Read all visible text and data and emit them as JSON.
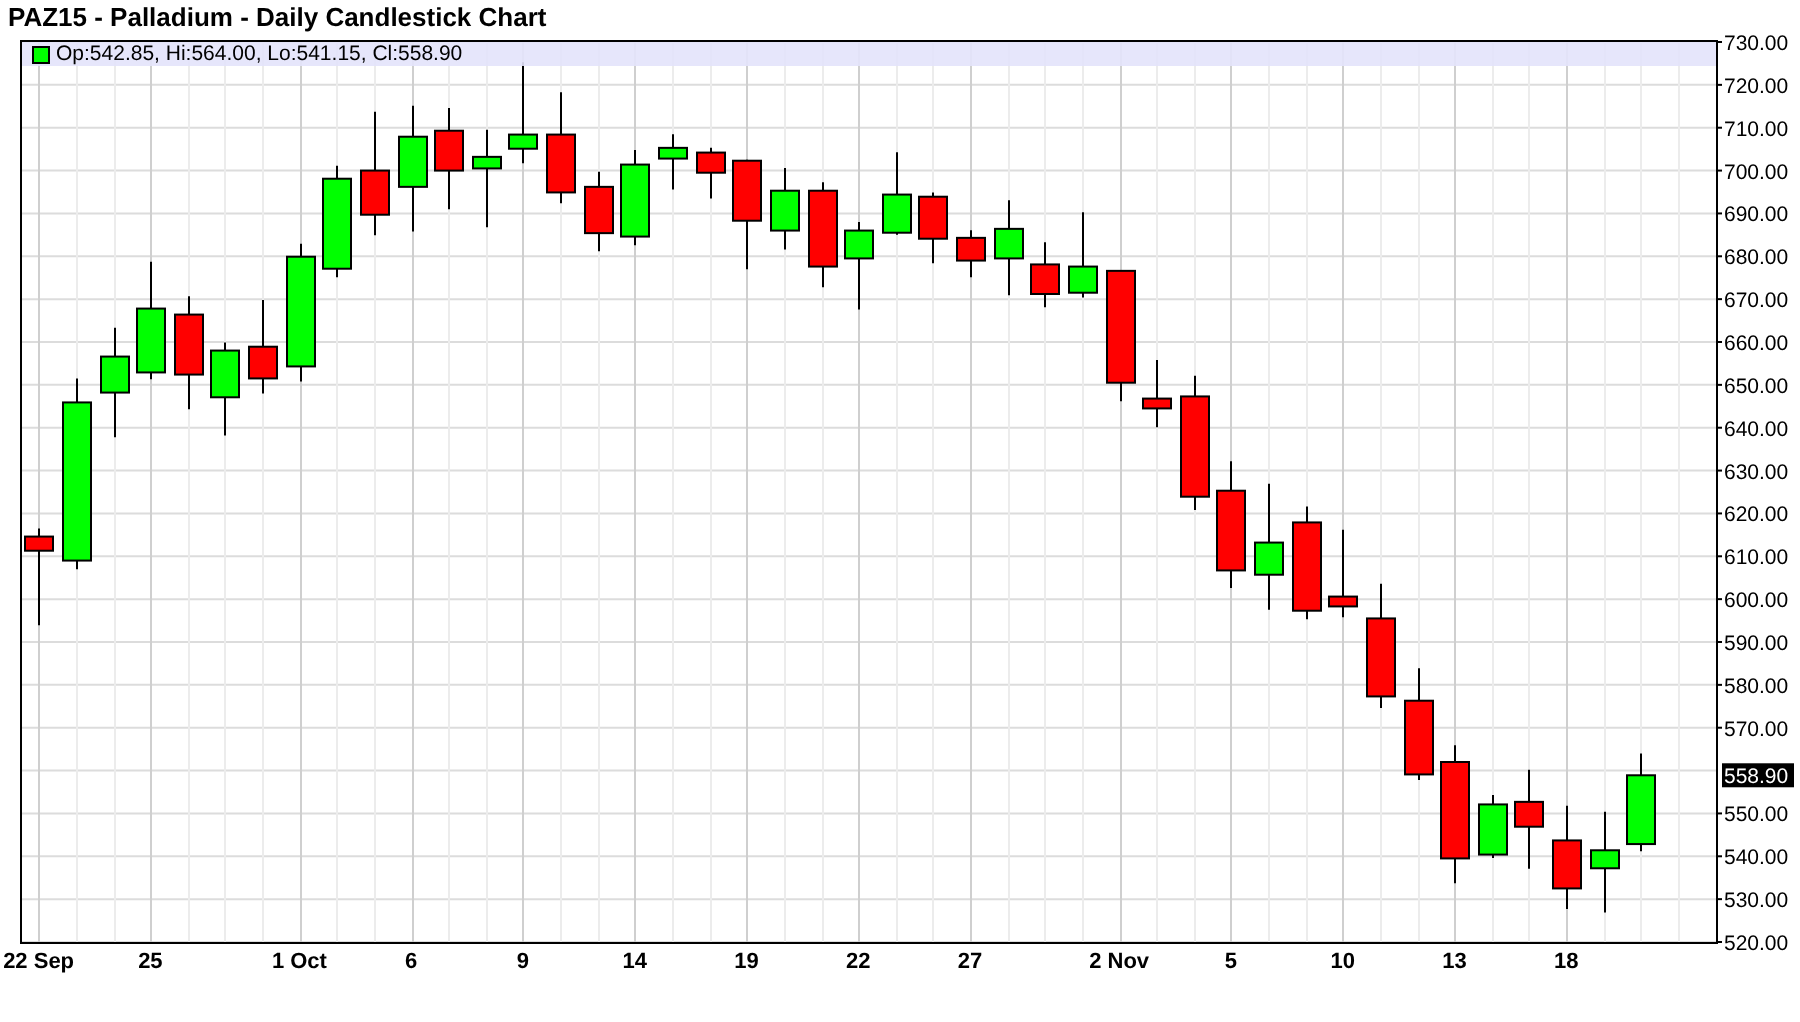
{
  "legend": {
    "text": "Op:542.85, Hi:564.00, Lo:541.15, Cl:558.90"
  },
  "last_price_label": "558.90",
  "chart_data": {
    "type": "candlestick",
    "title": "PAZ15 - Palladium - Daily Candlestick Chart",
    "categories": [
      "22 Sep",
      null,
      null,
      "25",
      null,
      null,
      null,
      "1 Oct",
      null,
      null,
      "6",
      null,
      null,
      "9",
      null,
      null,
      "14",
      null,
      null,
      "19",
      null,
      null,
      "22",
      null,
      null,
      "27",
      null,
      null,
      null,
      "2 Nov",
      null,
      null,
      "5",
      null,
      null,
      "10",
      null,
      null,
      "13",
      null,
      null,
      "18",
      null,
      null
    ],
    "ohlc": [
      [
        614.6,
        616.5,
        593.9,
        611.3
      ],
      [
        609.0,
        651.5,
        607.0,
        645.9
      ],
      [
        648.2,
        663.3,
        637.8,
        656.6
      ],
      [
        652.9,
        678.7,
        651.3,
        667.8
      ],
      [
        666.4,
        670.7,
        644.3,
        652.4
      ],
      [
        647.1,
        659.9,
        638.2,
        658.0
      ],
      [
        658.9,
        669.8,
        648.0,
        651.5
      ],
      [
        654.3,
        682.9,
        650.8,
        679.9
      ],
      [
        677.1,
        701.1,
        675.1,
        698.1
      ],
      [
        700.0,
        713.7,
        684.9,
        689.7
      ],
      [
        696.2,
        715.1,
        685.8,
        707.9
      ],
      [
        709.3,
        714.6,
        691.0,
        700.0
      ],
      [
        700.5,
        709.5,
        686.8,
        703.2
      ],
      [
        705.1,
        725.3,
        701.7,
        708.4
      ],
      [
        708.4,
        718.3,
        692.4,
        694.9
      ],
      [
        696.2,
        699.7,
        681.2,
        685.4
      ],
      [
        684.6,
        704.8,
        682.6,
        701.4
      ],
      [
        702.8,
        708.5,
        695.6,
        705.3
      ],
      [
        704.2,
        705.3,
        693.5,
        699.5
      ],
      [
        702.3,
        702.5,
        677.0,
        688.3
      ],
      [
        686.0,
        700.6,
        681.6,
        695.3
      ],
      [
        695.3,
        697.3,
        672.8,
        677.6
      ],
      [
        679.5,
        688.0,
        667.6,
        686.0
      ],
      [
        685.5,
        704.3,
        685.0,
        694.4
      ],
      [
        693.9,
        694.9,
        678.4,
        684.1
      ],
      [
        684.3,
        686.1,
        675.1,
        679.0
      ],
      [
        679.5,
        693.1,
        670.9,
        686.4
      ],
      [
        678.1,
        683.3,
        668.1,
        671.2
      ],
      [
        671.5,
        690.3,
        670.4,
        677.6
      ],
      [
        676.6,
        676.8,
        646.2,
        650.5
      ],
      [
        646.8,
        655.8,
        640.1,
        644.5
      ],
      [
        647.3,
        652.1,
        620.8,
        623.9
      ],
      [
        625.3,
        632.2,
        602.6,
        606.7
      ],
      [
        605.7,
        626.9,
        597.5,
        613.2
      ],
      [
        617.9,
        621.6,
        595.3,
        597.3
      ],
      [
        600.6,
        616.2,
        595.8,
        598.3
      ],
      [
        595.5,
        603.6,
        574.6,
        577.3
      ],
      [
        576.3,
        583.9,
        557.8,
        559.1
      ],
      [
        562.0,
        565.9,
        533.7,
        539.5
      ],
      [
        540.4,
        554.3,
        539.6,
        552.1
      ],
      [
        552.7,
        560.2,
        537.1,
        546.9
      ],
      [
        543.7,
        551.8,
        527.7,
        532.5
      ],
      [
        537.2,
        550.4,
        526.9,
        541.4
      ],
      [
        542.85,
        564.0,
        541.15,
        558.9
      ]
    ],
    "grid": true,
    "ylim": [
      520,
      730
    ],
    "yticks": [
      {
        "value": 730,
        "label": "730.00"
      },
      {
        "value": 720,
        "label": "720.00"
      },
      {
        "value": 710,
        "label": "710.00"
      },
      {
        "value": 700,
        "label": "700.00"
      },
      {
        "value": 690,
        "label": "690.00"
      },
      {
        "value": 680,
        "label": "680.00"
      },
      {
        "value": 670,
        "label": "670.00"
      },
      {
        "value": 660,
        "label": "660.00"
      },
      {
        "value": 650,
        "label": "650.00"
      },
      {
        "value": 640,
        "label": "640.00"
      },
      {
        "value": 630,
        "label": "630.00"
      },
      {
        "value": 620,
        "label": "620.00"
      },
      {
        "value": 610,
        "label": "610.00"
      },
      {
        "value": 600,
        "label": "600.00"
      },
      {
        "value": 590,
        "label": "590.00"
      },
      {
        "value": 580,
        "label": "580.00"
      },
      {
        "value": 570,
        "label": "570.00"
      },
      {
        "value": 550,
        "label": "550.00"
      },
      {
        "value": 540,
        "label": "540.00"
      },
      {
        "value": 530,
        "label": "530.00"
      },
      {
        "value": 520,
        "label": "520.00"
      }
    ]
  }
}
